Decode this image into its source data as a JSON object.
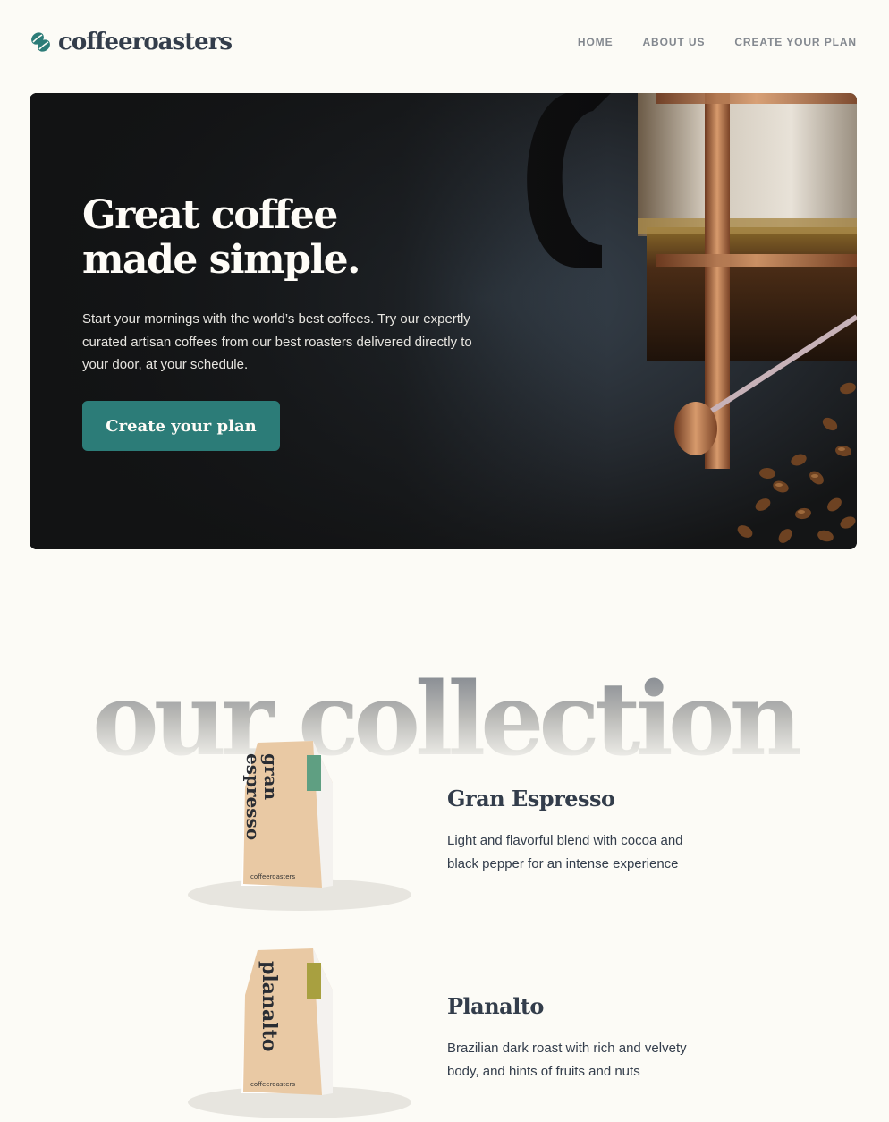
{
  "header": {
    "logo_text": "coffeeroasters",
    "nav": [
      {
        "label": "HOME"
      },
      {
        "label": "ABOUT US"
      },
      {
        "label": "CREATE YOUR PLAN"
      }
    ]
  },
  "hero": {
    "title": "Great coffee made simple.",
    "description": "Start your mornings with the world’s best coffees. Try our expertly curated artisan coffees from our best roasters delivered directly to your door, at your schedule.",
    "cta_label": "Create your plan"
  },
  "collection": {
    "heading": "our collection",
    "products": [
      {
        "name": "Gran Espresso",
        "description": "Light and flavorful blend with cocoa and black pepper for an intense experience",
        "bag_label": "gran espresso",
        "bag_brand": "coffeeroasters",
        "tag_color": "#5f9f82"
      },
      {
        "name": "Planalto",
        "description": "Brazilian dark roast with rich and velvety body, and hints of fruits and nuts",
        "bag_label": "planalto",
        "bag_brand": "coffeeroasters",
        "tag_color": "#a8a040"
      }
    ]
  },
  "colors": {
    "accent": "#2c7c78",
    "text_dark": "#333d4b",
    "nav_grey": "#83888f",
    "background": "#fcfbf6"
  }
}
